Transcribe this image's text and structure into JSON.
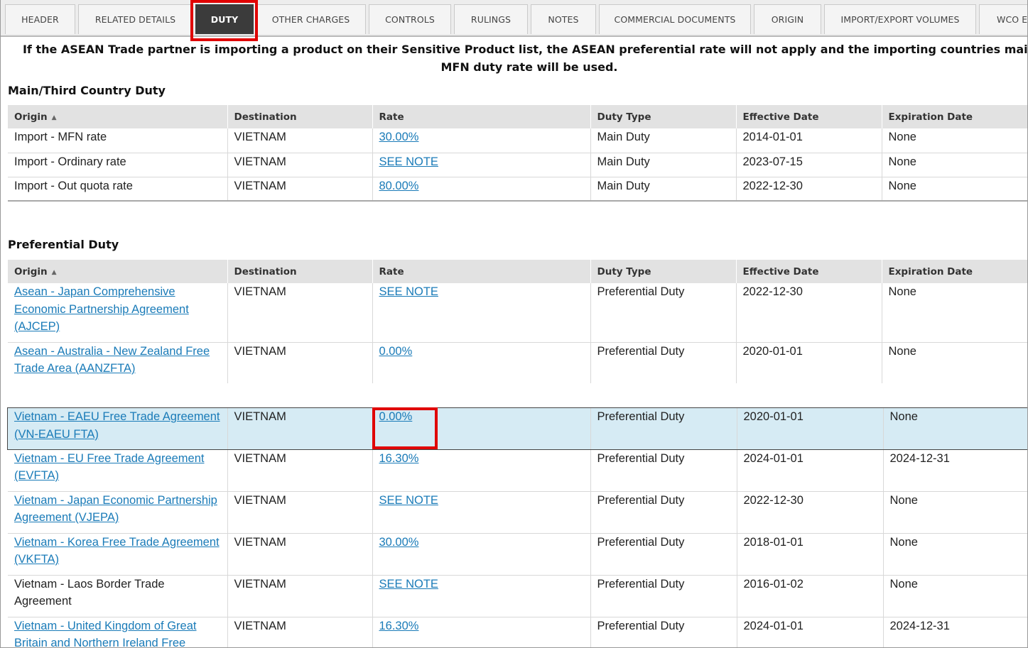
{
  "tabs": [
    {
      "label": "HEADER"
    },
    {
      "label": "RELATED DETAILS"
    },
    {
      "label": "DUTY"
    },
    {
      "label": "OTHER CHARGES"
    },
    {
      "label": "CONTROLS"
    },
    {
      "label": "RULINGS"
    },
    {
      "label": "NOTES"
    },
    {
      "label": "COMMERCIAL DOCUMENTS"
    },
    {
      "label": "ORIGIN"
    },
    {
      "label": "IMPORT/EXPORT VOLUMES"
    },
    {
      "label": "WCO E"
    }
  ],
  "active_tab": "DUTY",
  "notice": "If the ASEAN Trade partner is importing a product on their Sensitive Product list, the ASEAN preferential rate will not apply and the importing countries main MFN duty rate will be used.",
  "main_section": {
    "title": "Main/Third Country Duty",
    "columns": [
      "Origin",
      "Destination",
      "Rate",
      "Duty Type",
      "Effective Date",
      "Expiration Date"
    ],
    "rows": [
      {
        "origin": "Import - MFN rate",
        "destination": "VIETNAM",
        "rate": "30.00%",
        "duty_type": "Main Duty",
        "effective": "2014-01-01",
        "expiration": "None"
      },
      {
        "origin": "Import - Ordinary rate",
        "destination": "VIETNAM",
        "rate": "SEE NOTE",
        "duty_type": "Main Duty",
        "effective": "2023-07-15",
        "expiration": "None"
      },
      {
        "origin": "Import - Out quota rate",
        "destination": "VIETNAM",
        "rate": "80.00%",
        "duty_type": "Main Duty",
        "effective": "2022-12-30",
        "expiration": "None"
      }
    ]
  },
  "pref_section": {
    "title": "Preferential Duty",
    "columns": [
      "Origin",
      "Destination",
      "Rate",
      "Duty Type",
      "Effective Date",
      "Expiration Date"
    ],
    "rows_top": [
      {
        "origin": "Asean - Japan Comprehensive Economic Partnership Agreement (AJCEP)",
        "destination": "VIETNAM",
        "rate": "SEE NOTE",
        "duty_type": "Preferential Duty",
        "effective": "2022-12-30",
        "expiration": "None"
      },
      {
        "origin": "Asean - Australia - New Zealand Free Trade Area (AANZFTA)",
        "destination": "VIETNAM",
        "rate": "0.00%",
        "duty_type": "Preferential Duty",
        "effective": "2020-01-01",
        "expiration": "None"
      }
    ],
    "rows_bottom": [
      {
        "origin": "Vietnam - EAEU Free Trade Agreement (VN-EAEU FTA)",
        "destination": "VIETNAM",
        "rate": "0.00%",
        "duty_type": "Preferential Duty",
        "effective": "2020-01-01",
        "expiration": "None"
      },
      {
        "origin": "Vietnam - EU Free Trade Agreement (EVFTA)",
        "destination": "VIETNAM",
        "rate": "16.30%",
        "duty_type": "Preferential Duty",
        "effective": "2024-01-01",
        "expiration": "2024-12-31"
      },
      {
        "origin": "Vietnam - Japan Economic Partnership Agreement (VJEPA)",
        "destination": "VIETNAM",
        "rate": "SEE NOTE",
        "duty_type": "Preferential Duty",
        "effective": "2022-12-30",
        "expiration": "None"
      },
      {
        "origin": "Vietnam - Korea Free Trade Agreement (VKFTA)",
        "destination": "VIETNAM",
        "rate": "30.00%",
        "duty_type": "Preferential Duty",
        "effective": "2018-01-01",
        "expiration": "None"
      },
      {
        "origin": "Vietnam - Laos Border Trade Agreement",
        "destination": "VIETNAM",
        "rate": "SEE NOTE",
        "duty_type": "Preferential Duty",
        "effective": "2016-01-02",
        "expiration": "None"
      },
      {
        "origin": "Vietnam - United Kingdom of Great Britain and Northern Ireland Free",
        "destination": "VIETNAM",
        "rate": "16.30%",
        "duty_type": "Preferential Duty",
        "effective": "2024-01-01",
        "expiration": "2024-12-31"
      }
    ]
  }
}
